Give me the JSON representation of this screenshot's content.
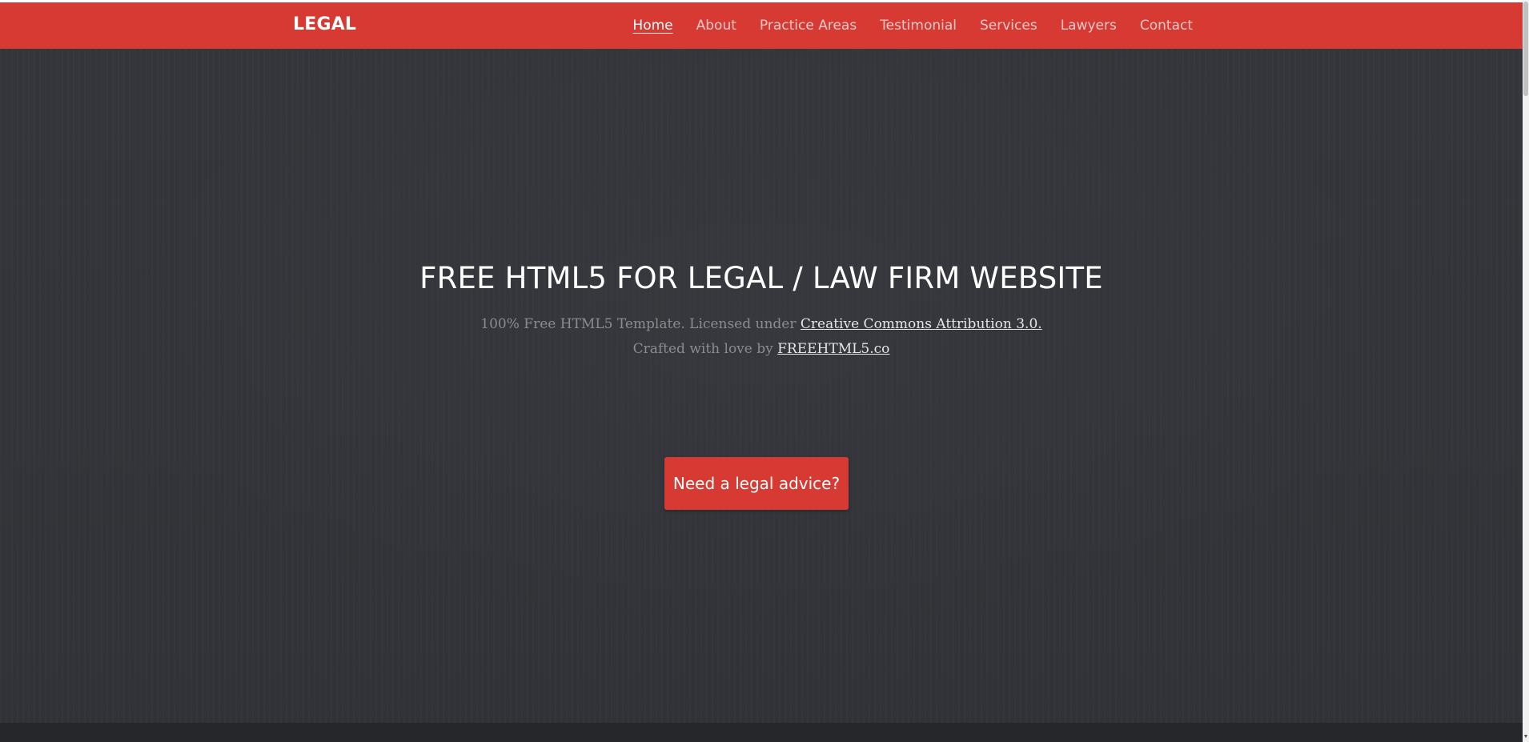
{
  "brand": {
    "name": "LEGAL"
  },
  "nav": {
    "items": [
      {
        "label": "Home",
        "active": true
      },
      {
        "label": "About",
        "active": false
      },
      {
        "label": "Practice Areas",
        "active": false
      },
      {
        "label": "Testimonial",
        "active": false
      },
      {
        "label": "Services",
        "active": false
      },
      {
        "label": "Lawyers",
        "active": false
      },
      {
        "label": "Contact",
        "active": false
      }
    ]
  },
  "hero": {
    "title": "FREE HTML5 FOR LEGAL / LAW FIRM WEBSITE",
    "line1_prefix": "100% Free HTML5 Template. Licensed under ",
    "license_link": "Creative Commons Attribution 3.0.",
    "line2_prefix": "Crafted with love by ",
    "credit_link": "FREEHTML5.co",
    "cta_label": "Need a legal advice?"
  },
  "scrollbar": {
    "down_arrow": "▼"
  },
  "colors": {
    "accent": "#d63a33",
    "hero_background": "#34363b",
    "bottom_band": "#25272b",
    "subtitle_text": "#8a8c90"
  },
  "icons": {
    "scroll_down": "scroll-down-arrow-icon"
  }
}
